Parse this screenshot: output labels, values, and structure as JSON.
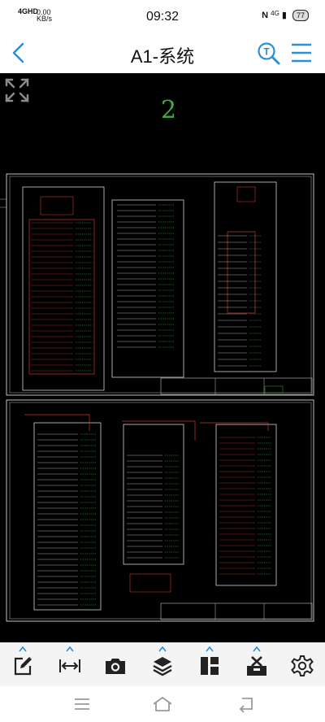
{
  "status_bar": {
    "network": "4GHD",
    "speed_value": "0.00",
    "speed_unit": "KB/s",
    "time": "09:32",
    "signal": "4G",
    "battery": "77"
  },
  "app_bar": {
    "title": "A1-系统"
  },
  "viewer": {
    "page_number": "2"
  },
  "icons": {
    "back": "back-arrow-icon",
    "search": "search-text-icon",
    "menu": "menu-icon",
    "expand": "fullscreen-icon",
    "toolbar": [
      "edit-icon",
      "measure-icon",
      "camera-icon",
      "layers-icon",
      "layout-icon",
      "toolbox-icon",
      "settings-icon"
    ],
    "nav": [
      "recent-apps-icon",
      "home-icon",
      "back-icon"
    ]
  },
  "colors": {
    "accent": "#2a8fd6",
    "drawing_red": "#c0392b",
    "drawing_green": "#3fae3f",
    "drawing_white": "#d8d8d8"
  }
}
